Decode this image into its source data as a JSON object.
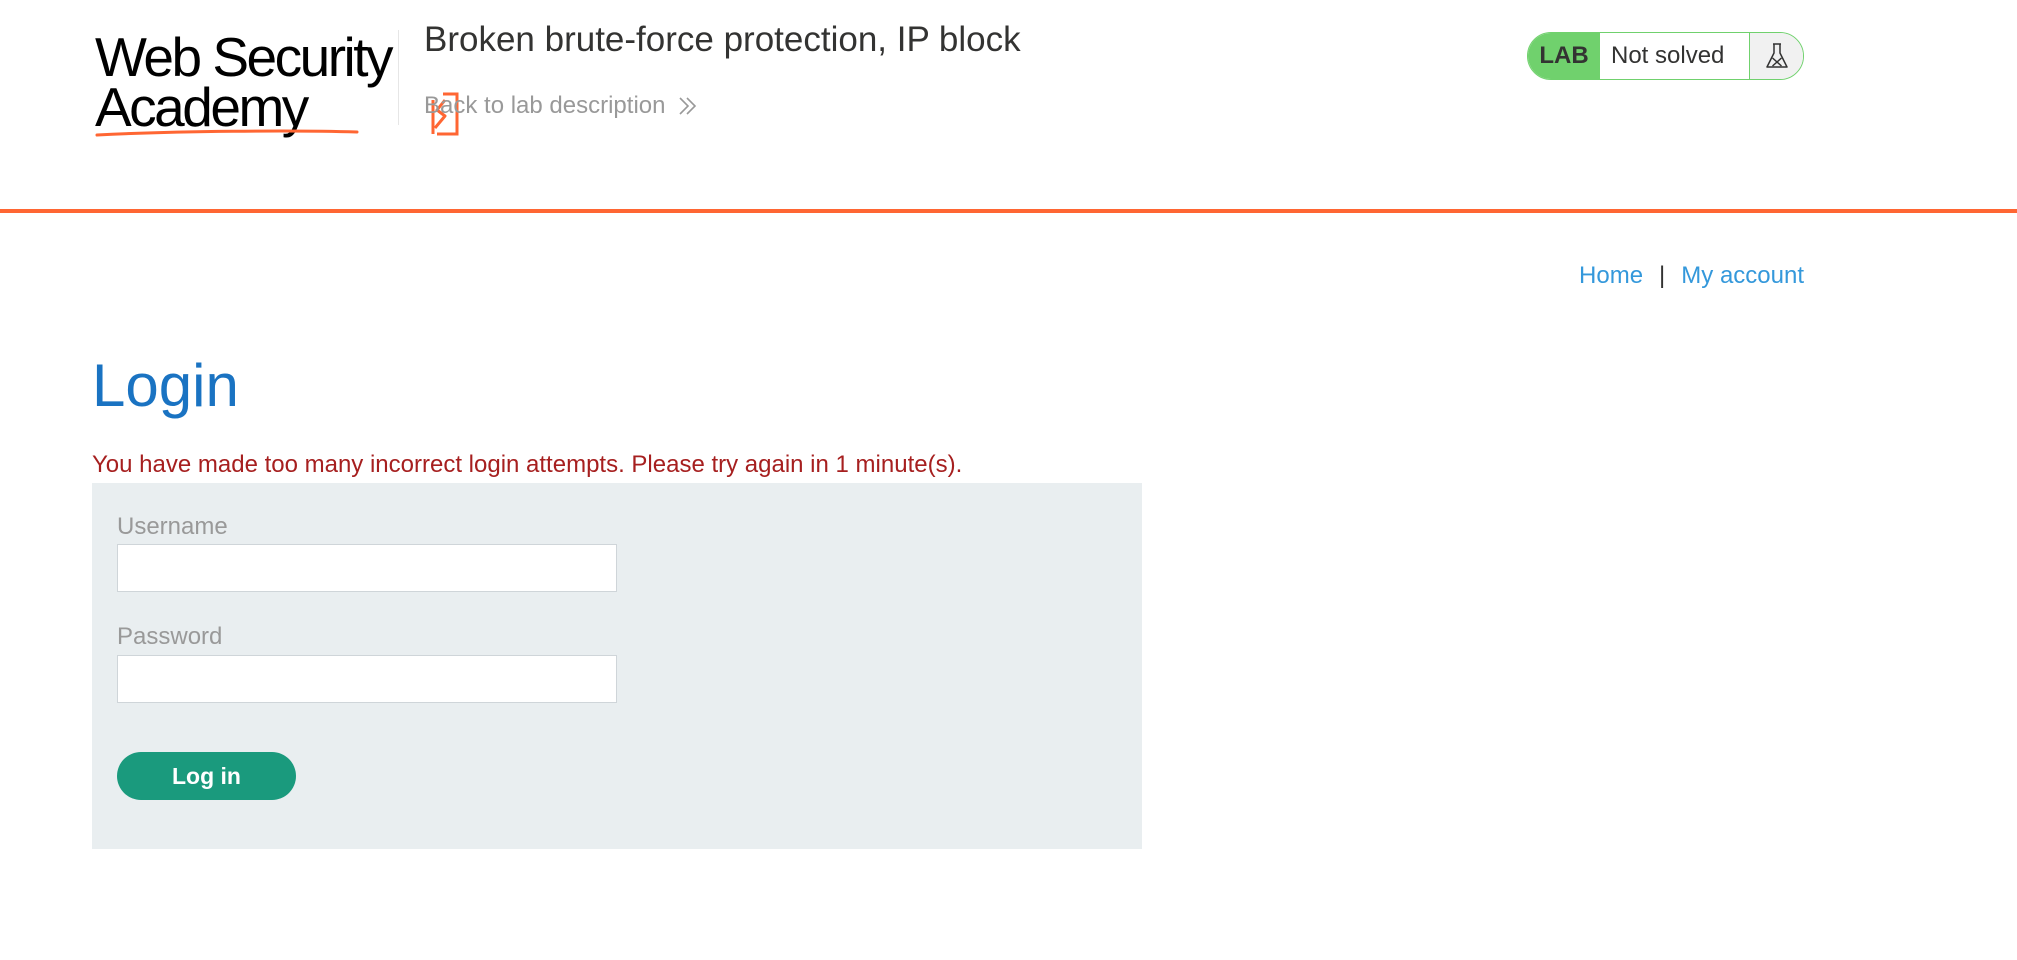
{
  "header": {
    "logo_line1": "Web Security",
    "logo_line2": "Academy",
    "lab_title": "Broken brute-force protection, IP block",
    "back_link_label": "Back to lab description"
  },
  "lab_status": {
    "badge": "LAB",
    "state": "Not solved",
    "icon": "flask-icon"
  },
  "nav": {
    "home": "Home",
    "separator": "|",
    "my_account": "My account"
  },
  "main": {
    "title": "Login",
    "error_message": "You have made too many incorrect login attempts. Please try again in 1 minute(s).",
    "form": {
      "username_label": "Username",
      "username_value": "",
      "password_label": "Password",
      "password_value": "",
      "submit_label": "Log in"
    }
  },
  "colors": {
    "accent_orange": "#ff6633",
    "lab_green": "#70d16d",
    "link_blue": "#3498db",
    "title_blue": "#1a73c2",
    "error_red": "#a61f1f",
    "button_teal": "#1a9a7d",
    "form_bg": "#e9eef0"
  }
}
